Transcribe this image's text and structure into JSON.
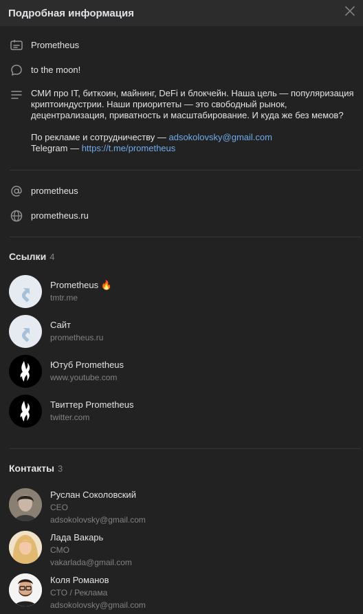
{
  "header": {
    "title": "Подробная информация"
  },
  "info": {
    "name": "Prometheus",
    "status": "to the moon!",
    "description_lines": [
      "СМИ про IT, биткоин, майнинг, DeFi и блокчейн. Наша цель — популяризация",
      "криптоиндустрии. Наши приоритеты — это свободный рынок,",
      "децентрализация, приватность и масштабирование. И куда же без мемов?"
    ],
    "ads_prefix": "По рекламе и сотрудничеству — ",
    "ads_email": "adsokolovsky@gmail.com",
    "telegram_prefix": "Telegram — ",
    "telegram_link": "https://t.me/prometheus",
    "short_name": "prometheus",
    "website": "prometheus.ru"
  },
  "links": {
    "title": "Ссылки",
    "count": "4",
    "items": [
      {
        "title": "Prometheus",
        "emoji": "🔥",
        "sub": "tmtr.me",
        "icon": "arrow-link-icon"
      },
      {
        "title": "Сайт",
        "sub": "prometheus.ru",
        "icon": "arrow-link-icon"
      },
      {
        "title": "Ютуб Prometheus",
        "sub": "www.youtube.com",
        "icon": "prometheus-logo"
      },
      {
        "title": "Твиттер Prometheus",
        "sub": "twitter.com",
        "icon": "prometheus-logo"
      }
    ]
  },
  "contacts": {
    "title": "Контакты",
    "count": "3",
    "items": [
      {
        "name": "Руслан Соколовский",
        "role": "CEO",
        "email": "adsokolovsky@gmail.com"
      },
      {
        "name": "Лада Вакарь",
        "role": "CMO",
        "email": "vakarlada@gmail.com"
      },
      {
        "name": "Коля Романов",
        "role": "CTO / Реклама",
        "email": "adsokolovsky@gmail.com"
      }
    ]
  },
  "colors": {
    "background": "#222222",
    "header": "#2c2c2c",
    "link": "#71aaeb",
    "secondary_text": "#828282"
  }
}
